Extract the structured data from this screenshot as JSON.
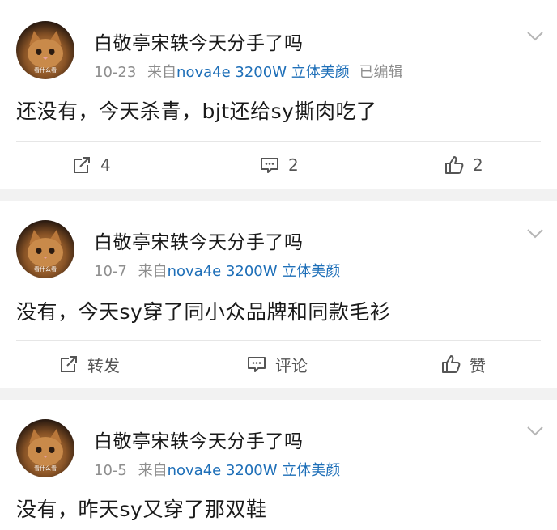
{
  "avatar_caption": "看什么看",
  "posts": [
    {
      "username": "白敬亭宋轶今天分手了吗",
      "date": "10-23",
      "source_prefix": "来自",
      "source": "nova4e 3200W 立体美颜",
      "edited": "已编辑",
      "content": "还没有，今天杀青，bjt还给sy撕肉吃了",
      "repost_label": "4",
      "comment_label": "2",
      "like_label": "2"
    },
    {
      "username": "白敬亭宋轶今天分手了吗",
      "date": "10-7",
      "source_prefix": "来自",
      "source": "nova4e 3200W 立体美颜",
      "content": "没有，今天sy穿了同小众品牌和同款毛衫",
      "repost_label": "转发",
      "comment_label": "评论",
      "like_label": "赞"
    },
    {
      "username": "白敬亭宋轶今天分手了吗",
      "date": "10-5",
      "source_prefix": "来自",
      "source": "nova4e 3200W 立体美颜",
      "content": "没有，昨天sy又穿了那双鞋"
    }
  ],
  "icons": {
    "repost": "repost-icon",
    "comment": "comment-icon",
    "like": "thumbs-up-icon",
    "menu": "chevron-down-icon"
  },
  "colors": {
    "source_link": "#1e6fb8",
    "meta": "#8e8e8e",
    "background": "#f2f2f2"
  }
}
